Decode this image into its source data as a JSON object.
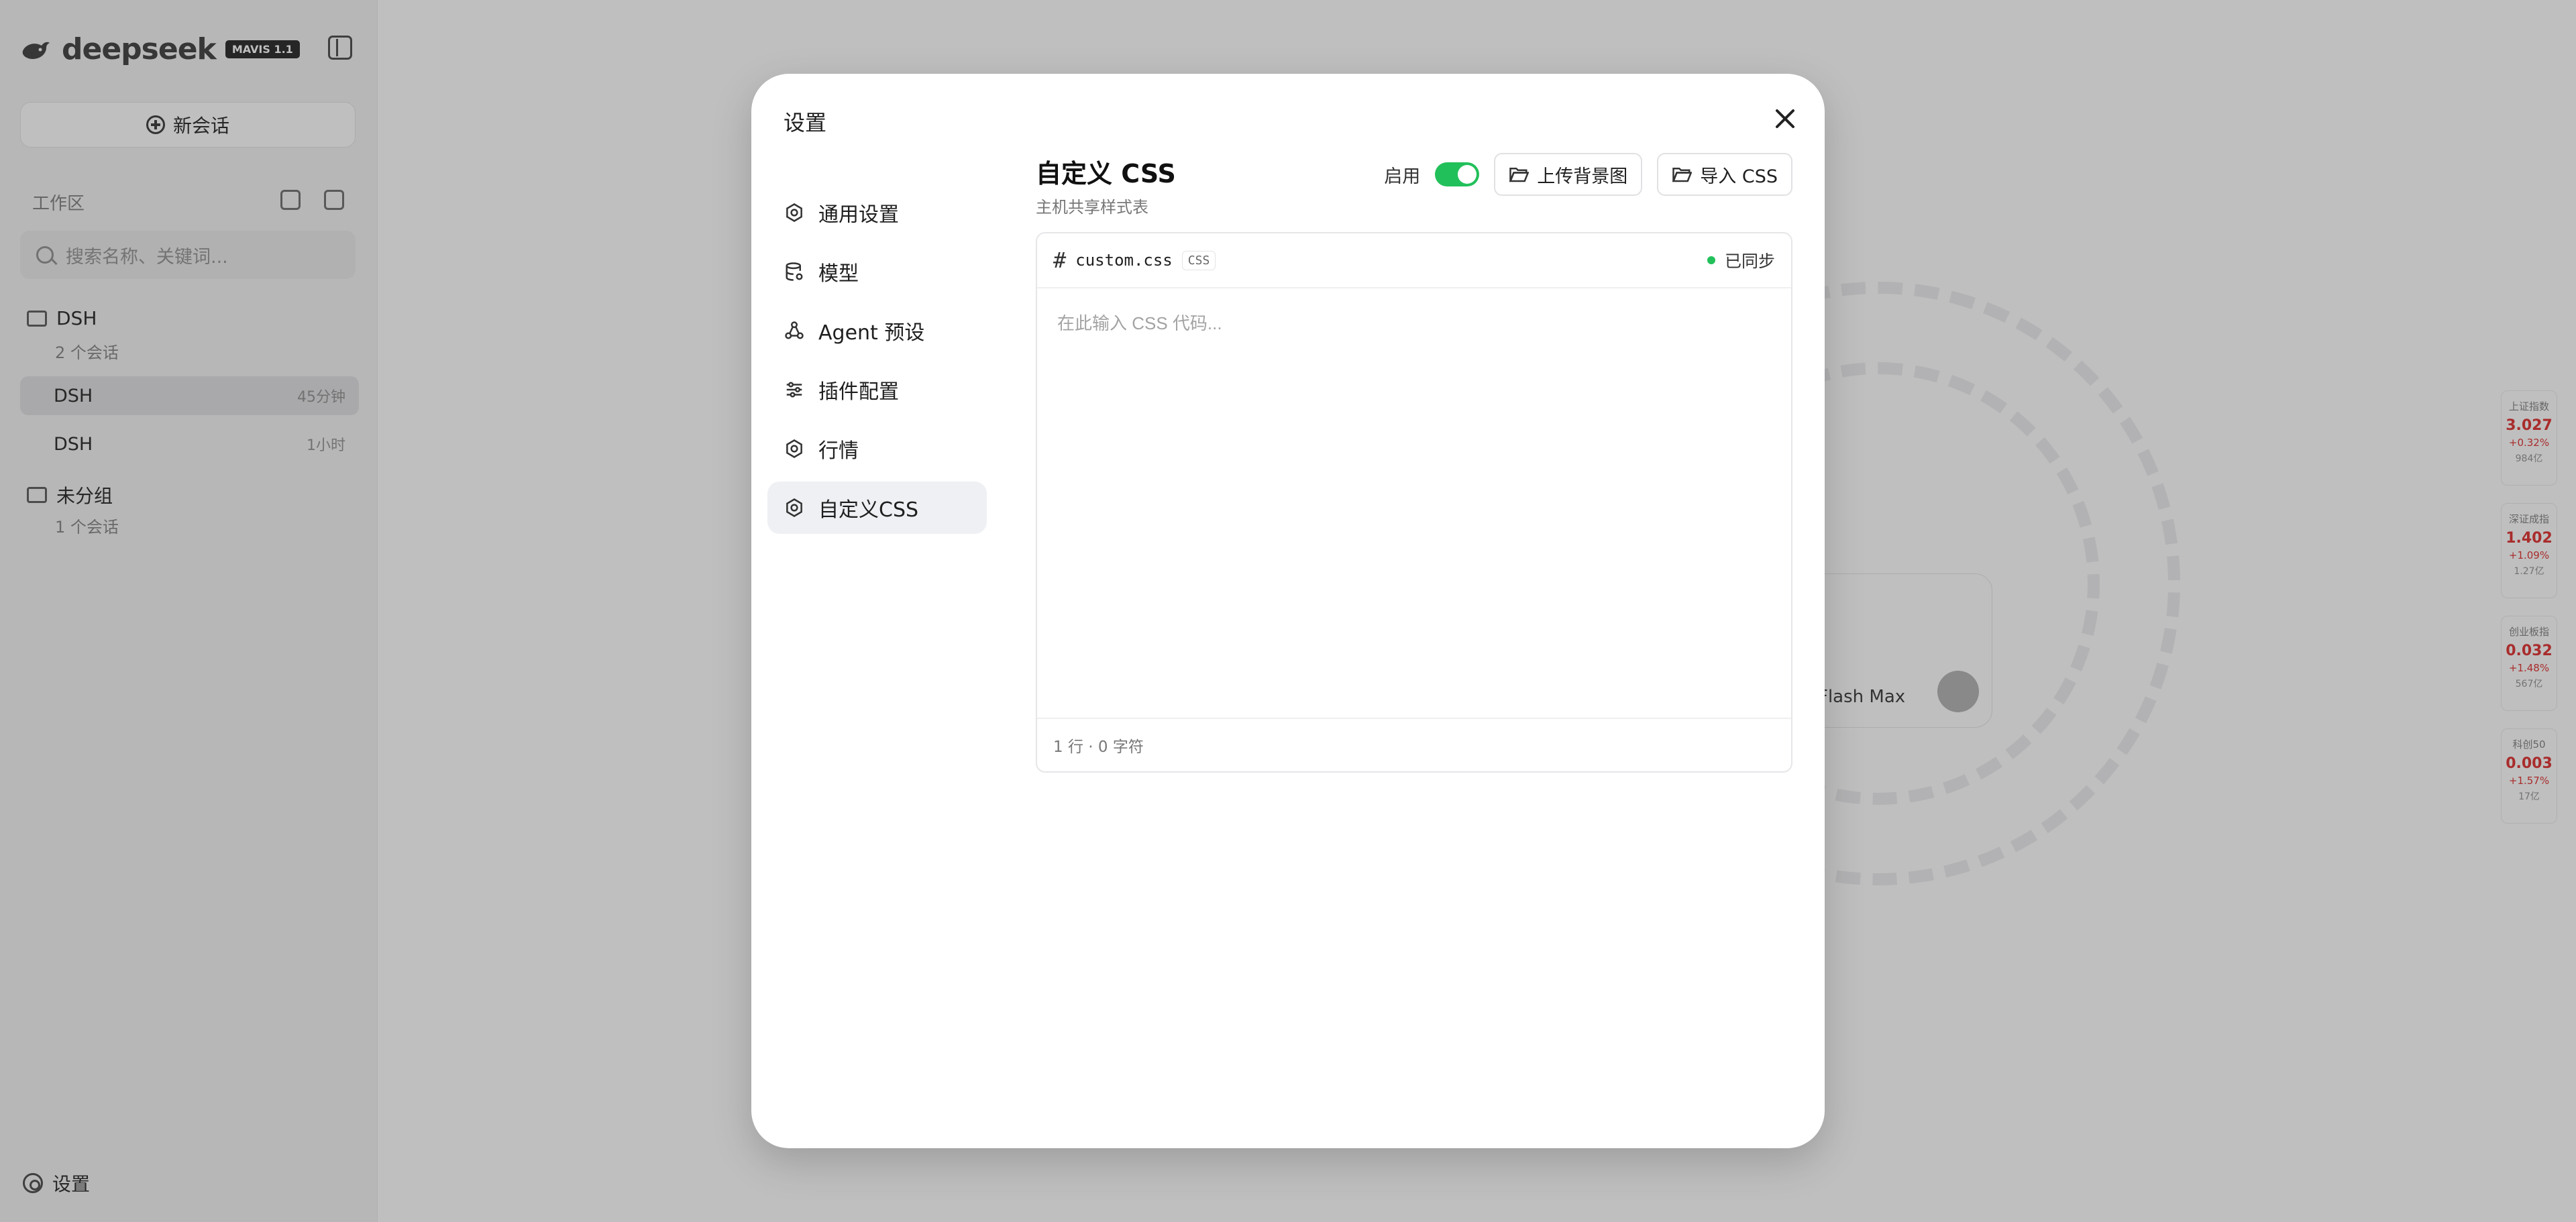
{
  "sidebar": {
    "brand": {
      "name": "deepseek",
      "badge": "MAVIS 1.1"
    },
    "new_chat": "新会话",
    "workspace_label": "工作区",
    "search_placeholder": "搜索名称、关键词...",
    "groups": [
      {
        "name": "DSH",
        "count": "2 个会话"
      },
      {
        "name": "未分组",
        "count": "1 个会话"
      }
    ],
    "conversations": [
      {
        "title": "DSH",
        "time": "45分钟"
      },
      {
        "title": "DSH",
        "time": "1小时"
      }
    ],
    "settings_label": "设置"
  },
  "background": {
    "composer_model": "Flash Max",
    "tickers": [
      {
        "name": "上证指数",
        "price": "3.027",
        "change": "+0.32%",
        "volume": "984亿"
      },
      {
        "name": "深证成指",
        "price": "1.402",
        "change": "+1.09%",
        "volume": "1.27亿"
      },
      {
        "name": "创业板指",
        "price": "0.032",
        "change": "+1.48%",
        "volume": "567亿"
      },
      {
        "name": "科创50",
        "price": "0.003",
        "change": "+1.57%",
        "volume": "17亿"
      }
    ]
  },
  "dialog": {
    "title": "设置",
    "nav": [
      {
        "label": "通用设置",
        "icon": "gear-icon"
      },
      {
        "label": "模型",
        "icon": "database-icon"
      },
      {
        "label": "Agent 预设",
        "icon": "agent-icon"
      },
      {
        "label": "插件配置",
        "icon": "sliders-icon"
      },
      {
        "label": "行情",
        "icon": "gear-icon"
      },
      {
        "label": "自定义CSS",
        "icon": "gear-icon"
      }
    ],
    "active_nav": "自定义CSS",
    "content": {
      "title": "自定义 CSS",
      "subtitle": "主机共享样式表",
      "enable_label": "启用",
      "enabled": true,
      "upload_bg_label": "上传背景图",
      "import_css_label": "导入 CSS",
      "editor": {
        "file_name": "custom.css",
        "lang": "CSS",
        "sync_status": "已同步",
        "placeholder": "在此输入 CSS 代码...",
        "value": "",
        "footer": "1 行 · 0 字符"
      }
    }
  },
  "colors": {
    "accent_green": "#22c05a",
    "overlay": "rgba(0,0,0,0.25)"
  }
}
